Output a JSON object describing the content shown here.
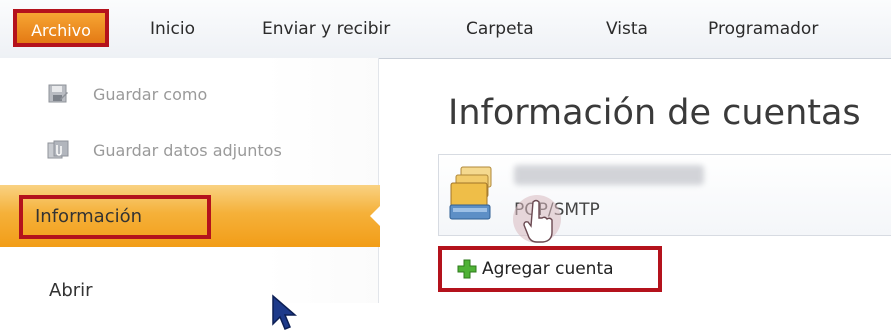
{
  "ribbon": {
    "tabs": [
      {
        "label": "Archivo"
      },
      {
        "label": "Inicio"
      },
      {
        "label": "Enviar y recibir"
      },
      {
        "label": "Carpeta"
      },
      {
        "label": "Vista"
      },
      {
        "label": "Programador"
      }
    ]
  },
  "backstage": {
    "commands": [
      {
        "label": "Guardar como",
        "icon": "save-as-icon"
      },
      {
        "label": "Guardar datos adjuntos",
        "icon": "save-attachments-icon"
      }
    ],
    "selected": {
      "label": "Información"
    },
    "next_item": {
      "label": "Abrir"
    }
  },
  "content": {
    "heading": "Información de cuentas",
    "account": {
      "type": "POP/SMTP",
      "icon": "accounts-folder-icon"
    },
    "add_account": {
      "label": "Agregar cuenta",
      "icon": "green-plus-icon"
    }
  },
  "colors": {
    "highlight_border": "#b4121c",
    "file_tab": "#e47a14",
    "selected_item": "#f5b13a"
  }
}
